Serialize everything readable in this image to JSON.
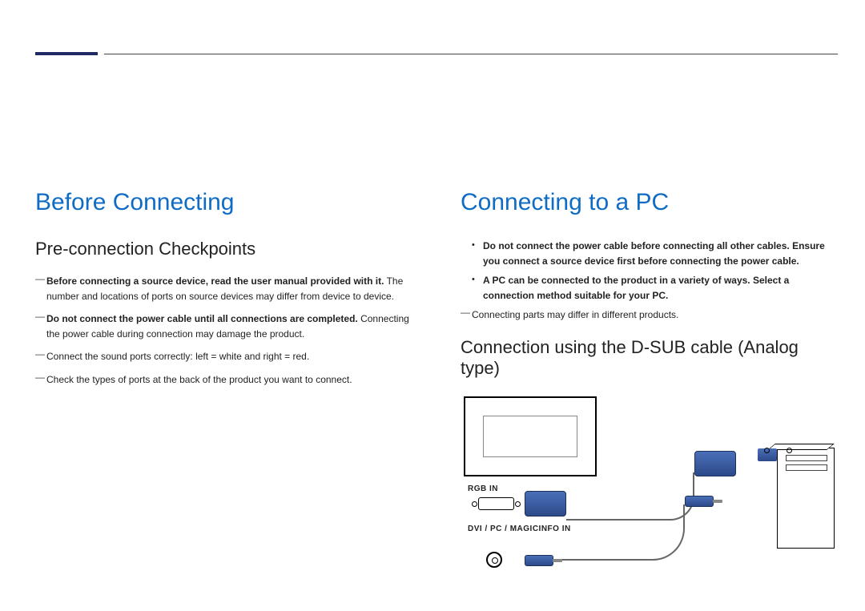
{
  "left": {
    "heading": "Before Connecting",
    "subheading": "Pre-connection Checkpoints",
    "items": [
      {
        "bold": "Before connecting a source device, read the user manual provided with it.",
        "rest": "The number and locations of ports on source devices may differ from device to device."
      },
      {
        "bold": "Do not connect the power cable until all connections are completed.",
        "rest": "Connecting the power cable during connection may damage the product."
      },
      {
        "bold": "",
        "rest": "Connect the sound ports correctly: left = white and right = red."
      },
      {
        "bold": "",
        "rest": "Check the types of ports at the back of the product you want to connect."
      }
    ]
  },
  "right": {
    "heading": "Connecting to a PC",
    "bullets": [
      "Do not connect the power cable before connecting all other cables. Ensure you connect a source device first before connecting the power cable.",
      "A PC can be connected to the product in a variety of ways. Select a connection method suitable for your PC."
    ],
    "dashnote": "Connecting parts may differ in different products.",
    "subheading": "Connection using the D-SUB cable (Analog type)",
    "rgb_label": "RGB IN",
    "dvi_label": "DVI / PC / MAGICINFO IN"
  }
}
